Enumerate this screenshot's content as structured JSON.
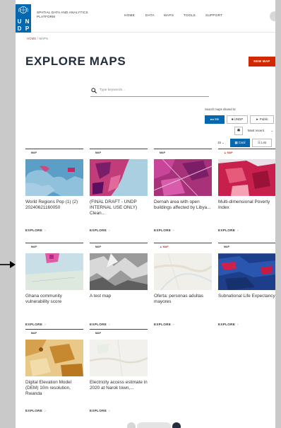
{
  "header": {
    "logo_letters": [
      "U",
      "N",
      "D",
      "P"
    ],
    "brand_line1": "SPATIAL DATA AND ANALYTICS",
    "brand_line2": "PLATFORM",
    "nav": [
      "HOME",
      "DATA",
      "MAPS",
      "TOOLS",
      "SUPPORT"
    ]
  },
  "breadcrumb": {
    "home": "HOME",
    "sep": "/",
    "current": "MAPS"
  },
  "page_title": "EXPLORE MAPS",
  "new_map_label": "NEW MAP",
  "search": {
    "placeholder": "Type keywords..."
  },
  "filters": {
    "shared_label": "Search maps shared to:",
    "share_buttons": [
      {
        "label": "Me",
        "active": true
      },
      {
        "label": "UNDP",
        "active": false
      },
      {
        "label": "Public",
        "active": false
      }
    ],
    "sort": "Most recent",
    "per_page": "15",
    "view": [
      {
        "label": "Card",
        "active": true
      },
      {
        "label": "List",
        "active": false
      }
    ]
  },
  "cards": [
    {
      "tag": "MAP",
      "title": "World Regions Pop (1) (2) 20240621160050",
      "explore": "EXPLORE",
      "restricted": false
    },
    {
      "tag": "MAP",
      "title": "(FINAL DRAFT - UNDP INTERNAL USE ONLY) Clean...",
      "explore": "EXPLORE",
      "restricted": false
    },
    {
      "tag": "MAP",
      "title": "Dernah area with open buildings affected by Libya...",
      "explore": "EXPLORE",
      "restricted": false
    },
    {
      "tag": "MAP",
      "title": "Multi-dimensional Poverty Index",
      "explore": "EXPLORE",
      "restricted": true
    },
    {
      "tag": "MAP",
      "title": "Ghana community vulnerability score",
      "explore": "EXPLORE",
      "restricted": false
    },
    {
      "tag": "MAP",
      "title": "A test map",
      "explore": "EXPLORE",
      "restricted": false
    },
    {
      "tag": "MAP",
      "title": "Oferta: personas adultas mayores",
      "explore": "EXPLORE",
      "restricted": true
    },
    {
      "tag": "MAP",
      "title": "Subnational Life Expectancy",
      "explore": "EXPLORE",
      "restricted": false
    },
    {
      "tag": "MAP",
      "title": "Digital Elevation Model (DEM) 10m resolution, Rwanda",
      "explore": "EXPLORE",
      "restricted": false
    },
    {
      "tag": "MAP",
      "title": "Electricity access estimate in 2020 at Narok town,...",
      "explore": "EXPLORE",
      "restricted": false
    }
  ],
  "colors": {
    "undp_blue": "#0468B1",
    "accent_red": "#D12800",
    "ink": "#232E3E"
  }
}
